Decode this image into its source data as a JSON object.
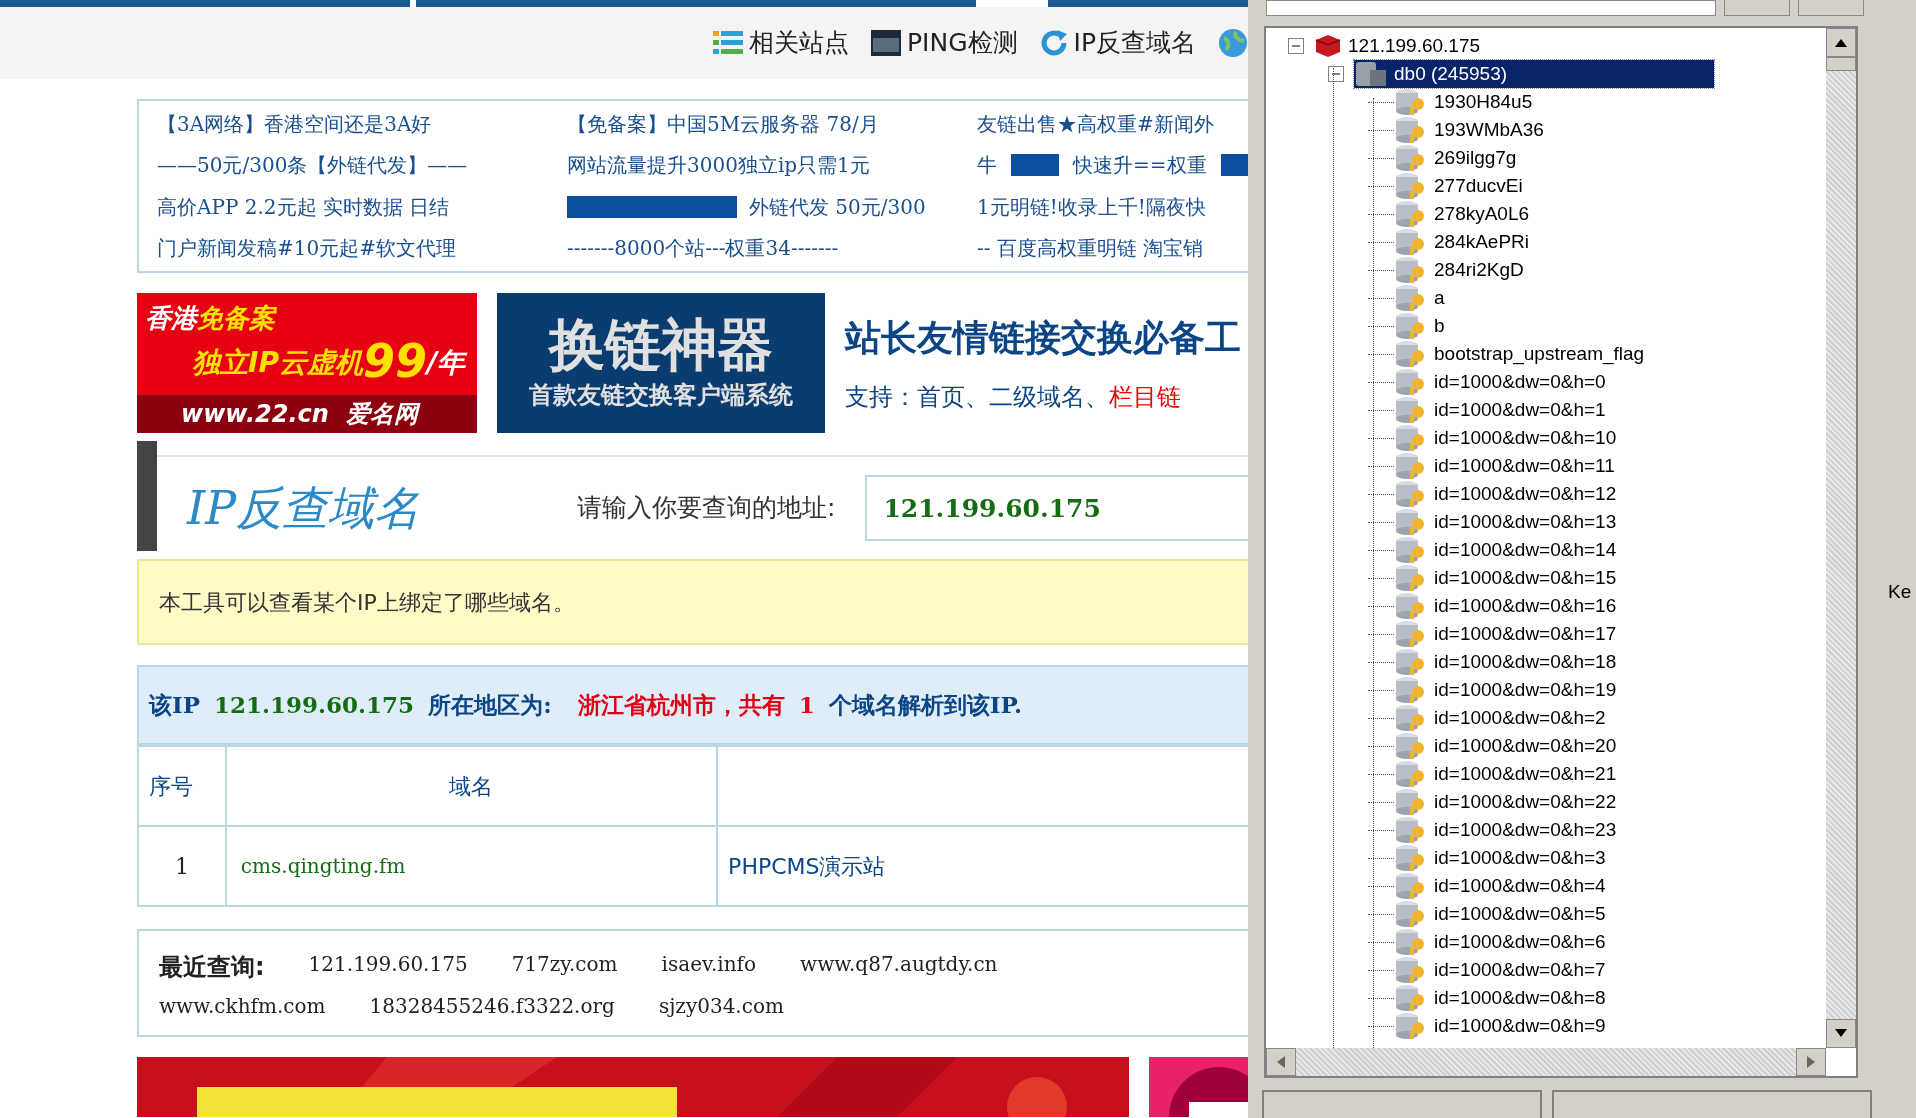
{
  "nav": [
    {
      "label": "相关站点"
    },
    {
      "label": "PING检测"
    },
    {
      "label": "IP反查域名"
    }
  ],
  "ad_links": [
    [
      "【3A网络】香港空间还是3A好",
      "——50元/300条【外链代发】——",
      "高价APP 2.2元起 实时数据 日结",
      "门户新闻发稿#10元起#软文代理"
    ],
    [
      "【免备案】中国5M云服务器 78/月",
      "网站流量提升3000独立ip只需1元",
      "外链代发 50元/300",
      "-------8000个站---权重34-------"
    ],
    [
      "友链出售★高权重#新闻外",
      "牛",
      "快速升==权重",
      "1元明链!收录上千!隔夜快",
      "-- 百度高权重明链 淘宝销"
    ]
  ],
  "banners": {
    "red": {
      "line_1a": "香港",
      "line_1b": "免备案",
      "line_2a": "独立IP云虚机",
      "line_2b": "99",
      "line_2c": "/年",
      "footer": "www.22.cn  爱名网"
    },
    "blue": {
      "title": "换链神器",
      "subtitle": "首款友链交换客户端系统"
    },
    "side": {
      "headline": "站长友情链接交换必备工",
      "support": "支持：首页、二级域名、",
      "support_red": "栏目链"
    }
  },
  "tool": {
    "title": "IP反查域名",
    "prompt": "请输入你要查询的地址:",
    "value": "121.199.60.175"
  },
  "note": "本工具可以查看某个IP上绑定了哪些域名。",
  "result": {
    "prefix": "该IP",
    "ip": "121.199.60.175",
    "region_label": "所在地区为:",
    "region": "浙江省杭州市，共有",
    "count": "1",
    "suffix": "个域名解析到该IP."
  },
  "table": {
    "columns": [
      "序号",
      "域名"
    ],
    "rows": [
      [
        "1",
        "cms.qingting.fm",
        "PHPCMS演示站"
      ]
    ]
  },
  "recent": {
    "label": "最近查询:",
    "links": [
      "121.199.60.175",
      "717zy.com",
      "isaev.info",
      "www.q87.augtdy.cn",
      "www.ckhfm.com",
      "18328455246.f3322.org",
      "sjzy034.com"
    ]
  },
  "tree": [
    {
      "label": "121.199.60.175",
      "kind": "server",
      "expanded": true,
      "selected": false,
      "children": [
        {
          "label": "db0 (245953)",
          "kind": "db",
          "expanded": true,
          "selected": true,
          "children": [
            {
              "label": "1930H84u5",
              "kind": "key",
              "selected": false
            },
            {
              "label": "193WMbA36",
              "kind": "key",
              "selected": false
            },
            {
              "label": "269ilgg7g",
              "kind": "key",
              "selected": false
            },
            {
              "label": "277ducvEi",
              "kind": "key",
              "selected": false
            },
            {
              "label": "278kyA0L6",
              "kind": "key",
              "selected": false
            },
            {
              "label": "284kAePRi",
              "kind": "key",
              "selected": false
            },
            {
              "label": "284ri2KgD",
              "kind": "key",
              "selected": false
            },
            {
              "label": "a",
              "kind": "key",
              "selected": false
            },
            {
              "label": "b",
              "kind": "key",
              "selected": false
            },
            {
              "label": "bootstrap_upstream_flag",
              "kind": "key",
              "selected": false
            },
            {
              "label": "id=1000&dw=0&h=0",
              "kind": "key",
              "selected": false
            },
            {
              "label": "id=1000&dw=0&h=1",
              "kind": "key",
              "selected": false
            },
            {
              "label": "id=1000&dw=0&h=10",
              "kind": "key",
              "selected": false
            },
            {
              "label": "id=1000&dw=0&h=11",
              "kind": "key",
              "selected": false
            },
            {
              "label": "id=1000&dw=0&h=12",
              "kind": "key",
              "selected": false
            },
            {
              "label": "id=1000&dw=0&h=13",
              "kind": "key",
              "selected": false
            },
            {
              "label": "id=1000&dw=0&h=14",
              "kind": "key",
              "selected": false
            },
            {
              "label": "id=1000&dw=0&h=15",
              "kind": "key",
              "selected": false
            },
            {
              "label": "id=1000&dw=0&h=16",
              "kind": "key",
              "selected": false
            },
            {
              "label": "id=1000&dw=0&h=17",
              "kind": "key",
              "selected": false
            },
            {
              "label": "id=1000&dw=0&h=18",
              "kind": "key",
              "selected": false
            },
            {
              "label": "id=1000&dw=0&h=19",
              "kind": "key",
              "selected": false
            },
            {
              "label": "id=1000&dw=0&h=2",
              "kind": "key",
              "selected": false
            },
            {
              "label": "id=1000&dw=0&h=20",
              "kind": "key",
              "selected": false
            },
            {
              "label": "id=1000&dw=0&h=21",
              "kind": "key",
              "selected": false
            },
            {
              "label": "id=1000&dw=0&h=22",
              "kind": "key",
              "selected": false
            },
            {
              "label": "id=1000&dw=0&h=23",
              "kind": "key",
              "selected": false
            },
            {
              "label": "id=1000&dw=0&h=3",
              "kind": "key",
              "selected": false
            },
            {
              "label": "id=1000&dw=0&h=4",
              "kind": "key",
              "selected": false
            },
            {
              "label": "id=1000&dw=0&h=5",
              "kind": "key",
              "selected": false
            },
            {
              "label": "id=1000&dw=0&h=6",
              "kind": "key",
              "selected": false
            },
            {
              "label": "id=1000&dw=0&h=7",
              "kind": "key",
              "selected": false
            },
            {
              "label": "id=1000&dw=0&h=8",
              "kind": "key",
              "selected": false
            },
            {
              "label": "id=1000&dw=0&h=9",
              "kind": "key",
              "selected": false
            }
          ]
        }
      ]
    }
  ],
  "side_label": "Ke"
}
